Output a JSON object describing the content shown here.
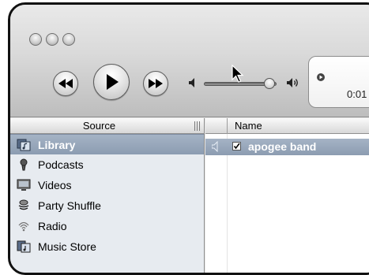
{
  "window": {
    "controls": [
      "close-button",
      "minimize-button",
      "zoom-button"
    ]
  },
  "toolbar": {
    "buttons": [
      "previous-track",
      "play",
      "next-track"
    ],
    "volume_level": 0.9,
    "lcd_time": "0:01"
  },
  "source": {
    "header": "Source",
    "items": [
      {
        "label": "Library",
        "icon": "library-icon",
        "selected": true
      },
      {
        "label": "Podcasts",
        "icon": "podcast-icon",
        "selected": false
      },
      {
        "label": "Videos",
        "icon": "video-icon",
        "selected": false
      },
      {
        "label": "Party Shuffle",
        "icon": "party-shuffle-icon",
        "selected": false
      },
      {
        "label": "Radio",
        "icon": "radio-icon",
        "selected": false
      },
      {
        "label": "Music Store",
        "icon": "music-store-icon",
        "selected": false
      }
    ]
  },
  "list": {
    "columns": [
      "Name"
    ],
    "rows": [
      {
        "name": "apogee band",
        "checked": true,
        "selected": true
      }
    ]
  },
  "colors": {
    "selection": "#96a6bb",
    "sidebar": "#e7ebf0"
  }
}
